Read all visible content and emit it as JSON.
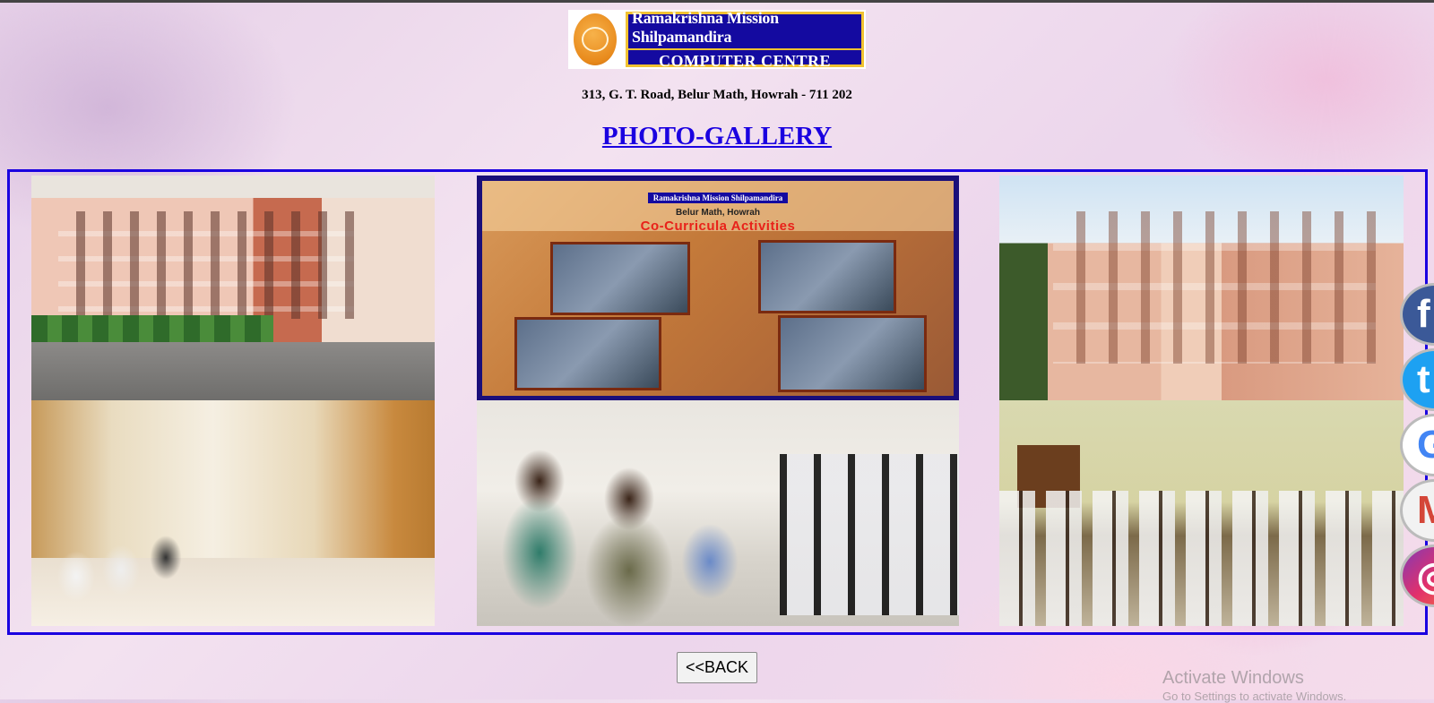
{
  "header": {
    "logo_line1": "Ramakrishna Mission Shilpamandira",
    "logo_line2": "COMPUTER CENTRE",
    "address": "313, G. T. Road, Belur Math, Howrah - 711 202",
    "title": "PHOTO-GALLERY"
  },
  "gallery": {
    "banner": {
      "org": "Ramakrishna Mission Shilpamandira",
      "org_sub": "COMPUTER CENTRE",
      "place": "Belur Math, Howrah",
      "caption": "Co-Curricula Activities"
    }
  },
  "back_button": {
    "label": "<<BACK"
  },
  "social": [
    {
      "name": "facebook-icon",
      "glyph": "f"
    },
    {
      "name": "twitter-icon",
      "glyph": "t"
    },
    {
      "name": "google-icon",
      "glyph": "G"
    },
    {
      "name": "gmail-icon",
      "glyph": "M"
    },
    {
      "name": "instagram-icon",
      "glyph": "◎"
    }
  ],
  "watermark": {
    "line1": "Activate Windows",
    "line2": "Go to Settings to activate Windows."
  },
  "colors": {
    "title": "#1a00e0",
    "gallery_border": "#1a00e0",
    "logo_bg": "#140aa0",
    "logo_accent": "#f1c232"
  }
}
